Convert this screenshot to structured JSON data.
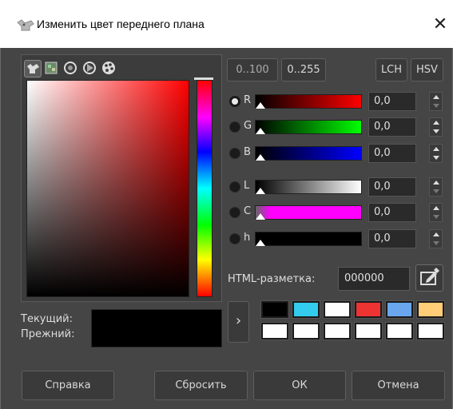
{
  "window": {
    "title": "Изменить цвет переднего плана",
    "close_glyph": "✕"
  },
  "selector_modes": [
    "gimp-selector-icon",
    "watercolor-icon",
    "wheel-icon",
    "triangle-icon",
    "palette-icon"
  ],
  "range_buttons": [
    "0..100",
    "0..255"
  ],
  "model_buttons": [
    "LCH",
    "HSV"
  ],
  "channels": [
    {
      "label": "R",
      "value": "0,0",
      "selected": true,
      "gradient": [
        "#000000",
        "#ff0000"
      ]
    },
    {
      "label": "G",
      "value": "0,0",
      "selected": false,
      "gradient": [
        "#000000",
        "#00ff00"
      ]
    },
    {
      "label": "B",
      "value": "0,0",
      "selected": false,
      "gradient": [
        "#000000",
        "#0000ff"
      ]
    },
    {
      "label": "L",
      "value": "0,0",
      "selected": false,
      "gradient": [
        "#000000",
        "#ffffff"
      ]
    },
    {
      "label": "C",
      "value": "0,0",
      "selected": false,
      "gradient": [
        "#ff00ff",
        "#ff00ff"
      ]
    },
    {
      "label": "h",
      "value": "0,0",
      "selected": false,
      "gradient": [
        "#000000",
        "#000000"
      ]
    }
  ],
  "html_notation": {
    "label": "HTML-разметка:",
    "value": "000000"
  },
  "compare": {
    "current_label": "Текущий:",
    "previous_label": "Прежний:"
  },
  "history_arrow": "›",
  "history_colors": [
    "#000000",
    "#33ccee",
    "#ffffff",
    "#ee3333",
    "#6aa6ee",
    "#ffcc77",
    "#ffffff",
    "#ffffff",
    "#ffffff",
    "#ffffff",
    "#ffffff",
    "#ffffff"
  ],
  "buttons": {
    "help": "Справка",
    "reset": "Сбросить",
    "ok": "ОК",
    "cancel": "Отмена"
  }
}
